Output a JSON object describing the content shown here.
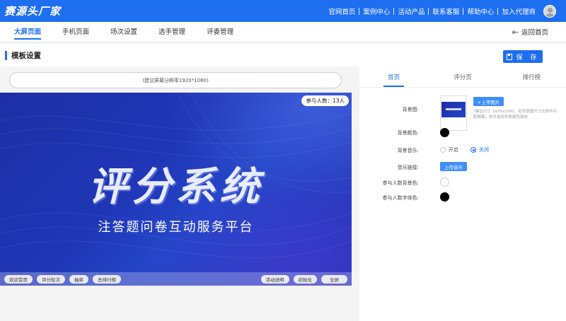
{
  "header": {
    "brand": "赛源头厂家",
    "nav": [
      "官网首页",
      "案例中心",
      "活动产品",
      "联系客服",
      "帮助中心",
      "加入代理商"
    ]
  },
  "tabs": {
    "items": [
      "大屏页面",
      "手机页面",
      "场次设置",
      "选手管理",
      "评委管理"
    ],
    "active": 0,
    "back_home": "返回首页"
  },
  "section": {
    "title": "模板设置",
    "save_label": "保 存"
  },
  "preview": {
    "resolution_hint": "(建议屏幕分辨率1920*1080)",
    "participants": "参与人数：13人",
    "main_title": "评分系统",
    "subtitle": "注答题问卷互动服务平台",
    "footer_left": [
      "欢迎首页",
      "评分轮次",
      "抽奖",
      "总排行榜"
    ],
    "footer_right": [
      "活动说明",
      "初始化",
      "全屏"
    ]
  },
  "settings": {
    "tabs": [
      "首页",
      "评分页",
      "排行榜"
    ],
    "active_tab": 0,
    "bg_image_label": "背景图:",
    "upload_image_btn": "+上传图片",
    "upload_hint": "*建议尺寸 1920x1080，若背景图尺寸比例不匹配屏幕，则可选用背景颜色填充",
    "bg_color_label": "背景颜色:",
    "bg_color": "#000000",
    "bg_music_label": "背景音乐:",
    "music_on": "开启",
    "music_off": "关闭",
    "music_link_label": "音乐链接:",
    "upload_music_btn": "上传音乐",
    "participant_bg_label": "参与人数背景色:",
    "participant_bg_color": "#ffffff",
    "participant_font_label": "参与人数字体色:",
    "participant_font_color": "#000000"
  },
  "colors": {
    "primary": "#1d6ff0",
    "screen_bg": "#1f36b6"
  }
}
